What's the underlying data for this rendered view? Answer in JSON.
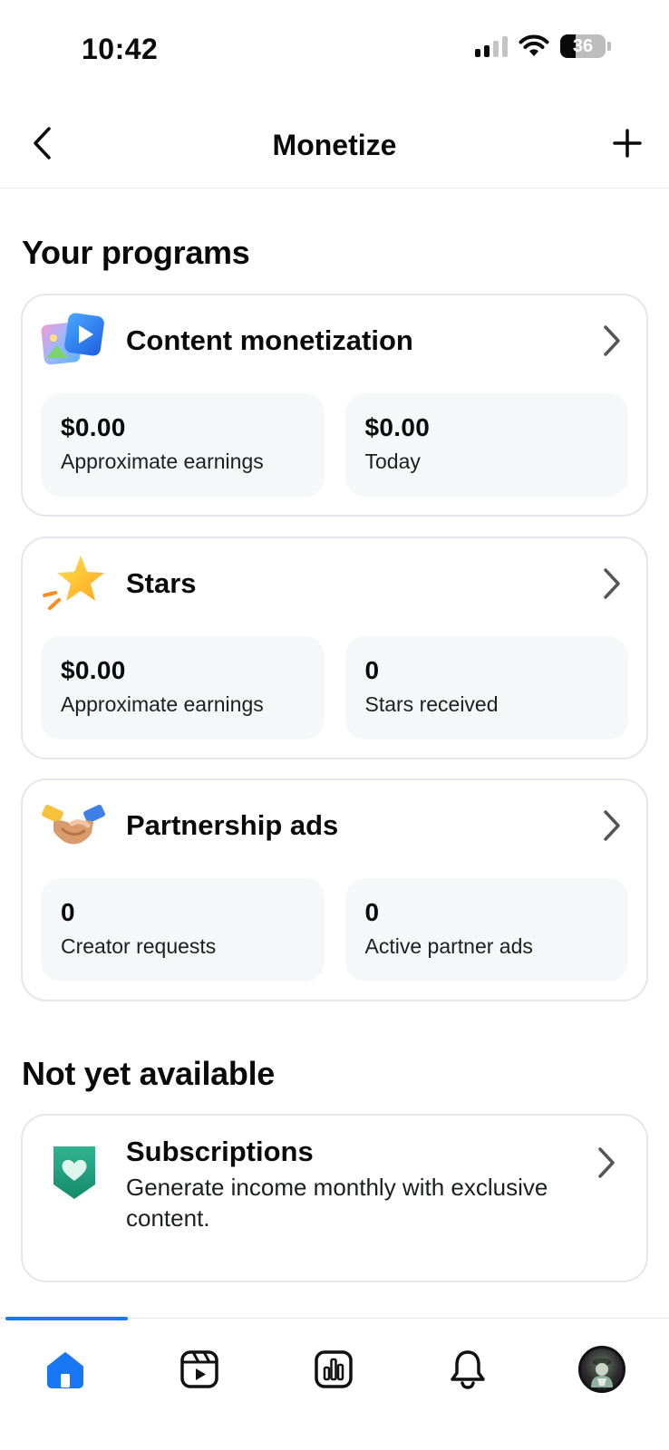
{
  "status_bar": {
    "time": "10:42",
    "battery_level": "36"
  },
  "header": {
    "title": "Monetize"
  },
  "programs_section": {
    "title": "Your programs",
    "cards": [
      {
        "title": "Content monetization",
        "icon": "video-photo-icon",
        "stats": [
          {
            "value": "$0.00",
            "label": "Approximate earnings"
          },
          {
            "value": "$0.00",
            "label": "Today"
          }
        ]
      },
      {
        "title": "Stars",
        "icon": "star-icon",
        "stats": [
          {
            "value": "$0.00",
            "label": "Approximate earnings"
          },
          {
            "value": "0",
            "label": "Stars received"
          }
        ]
      },
      {
        "title": "Partnership ads",
        "icon": "handshake-icon",
        "stats": [
          {
            "value": "0",
            "label": "Creator requests"
          },
          {
            "value": "0",
            "label": "Active partner ads"
          }
        ]
      }
    ]
  },
  "unavailable_section": {
    "title": "Not yet available",
    "subscriptions": {
      "title": "Subscriptions",
      "description": "Generate income monthly with exclusive content.",
      "icon": "heart-shield-icon"
    }
  },
  "tab_bar": {
    "active_tab": "home",
    "tabs": [
      "home-icon",
      "reels-icon",
      "insights-icon",
      "notifications-icon",
      "profile-avatar"
    ]
  },
  "colors": {
    "accent": "#1877f2",
    "card_border": "#e4e6eb",
    "stat_bg": "#f6f7f9",
    "text": "#0a0a0a"
  }
}
